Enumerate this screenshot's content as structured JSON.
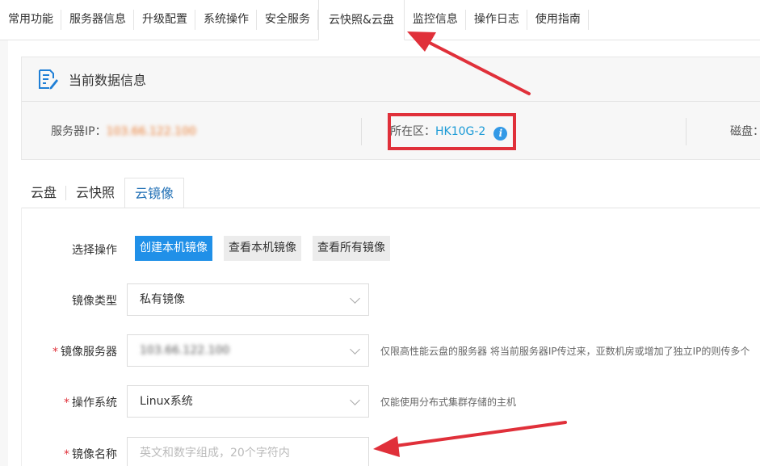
{
  "top_tabs": [
    {
      "label": "常用功能"
    },
    {
      "label": "服务器信息"
    },
    {
      "label": "升级配置"
    },
    {
      "label": "系统操作"
    },
    {
      "label": "安全服务"
    },
    {
      "label": "云快照&云盘"
    },
    {
      "label": "监控信息"
    },
    {
      "label": "操作日志"
    },
    {
      "label": "使用指南"
    }
  ],
  "info": {
    "title": "当前数据信息",
    "server_ip_label": "服务器IP：",
    "server_ip_value": "103.66.122.100",
    "zone_label": "所在区：",
    "zone_value": "HK10G-2",
    "disk_label": "磁盘："
  },
  "sub_tabs": [
    {
      "label": "云盘"
    },
    {
      "label": "云快照"
    },
    {
      "label": "云镜像"
    }
  ],
  "form": {
    "action_label": "选择操作",
    "buttons": {
      "create": "创建本机镜像",
      "view_local": "查看本机镜像",
      "view_all": "查看所有镜像"
    },
    "image_type": {
      "label": "镜像类型",
      "value": "私有镜像"
    },
    "image_server": {
      "label": "镜像服务器",
      "value": "103.66.122.100",
      "hint": "仅限高性能云盘的服务器 将当前服务器IP传过来，亚数机房或增加了独立IP的则传多个"
    },
    "os": {
      "label": "操作系统",
      "value": "Linux系统",
      "hint": "仅能使用分布式集群存储的主机"
    },
    "image_name": {
      "label": "镜像名称",
      "placeholder": "英文和数字组成，20个字符内"
    }
  },
  "colors": {
    "accent": "#2090e8",
    "annotation": "#e0303a",
    "link": "#1a9ad6"
  }
}
